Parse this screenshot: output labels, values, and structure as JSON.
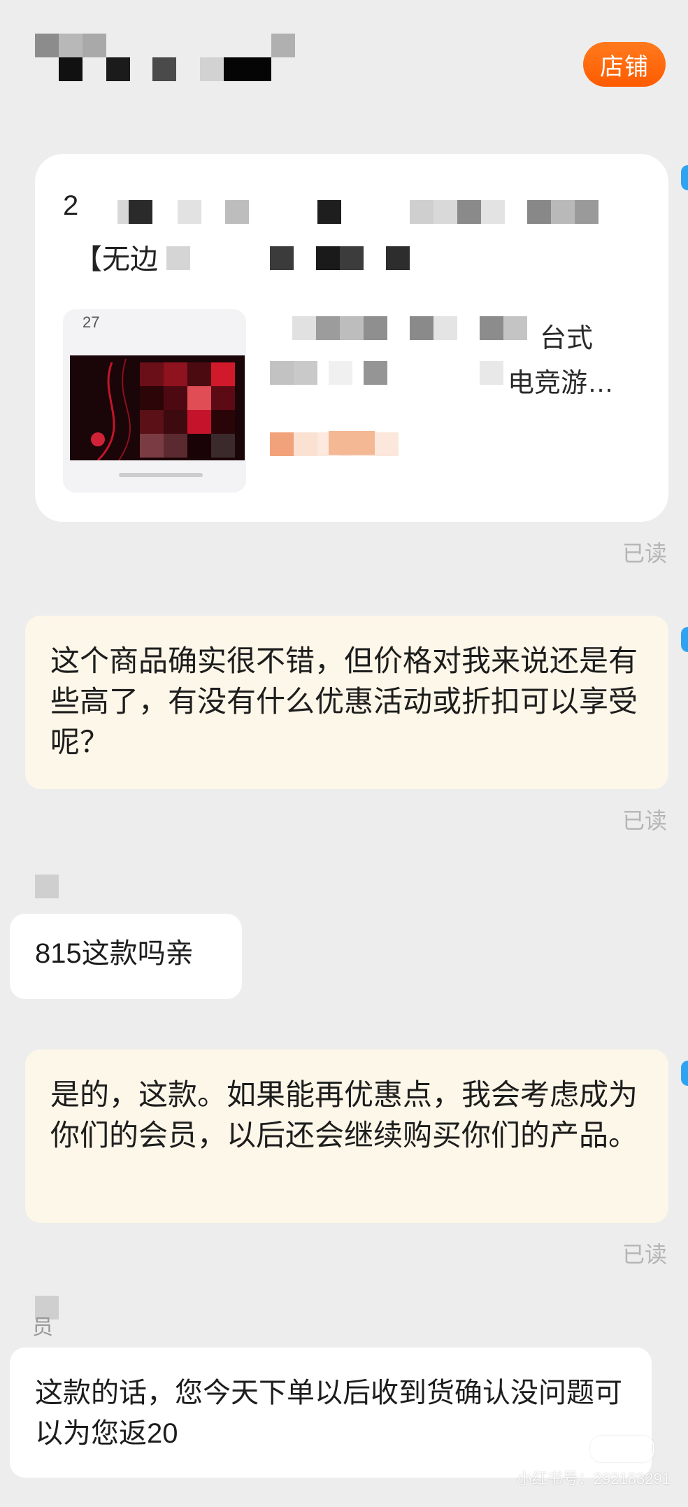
{
  "header": {
    "shop_button": "店铺"
  },
  "product_card": {
    "title_line1": "2",
    "title_line2": "【无边",
    "thumb_label": "27",
    "desc_line1": "台式",
    "desc_line2": "电竞游…",
    "read_status": "已读"
  },
  "messages": [
    {
      "side": "right",
      "text": "这个商品确实很不错，但价格对我来说还是有些高了，有没有什么优惠活动或折扣可以享受呢？",
      "status": "已读"
    },
    {
      "side": "left",
      "text": "815这款吗亲"
    },
    {
      "side": "right",
      "text": "是的，这款。如果能再优惠点，我会考虑成为你们的会员，以后还会继续购买你们的产品。",
      "status": "已读"
    },
    {
      "side": "left",
      "sender_fragment": "员",
      "text": "这款的话，您今天下单以后收到货确认没问题可以为您返20"
    }
  ],
  "watermark": {
    "badge": "小红书",
    "id_text": "小红书号：292183291"
  },
  "colors": {
    "background": "#ededed",
    "shop_button": "#ff6a0e",
    "outgoing_bubble": "#fdf7e9",
    "incoming_bubble": "#ffffff",
    "read_text": "#b5b5b5"
  }
}
